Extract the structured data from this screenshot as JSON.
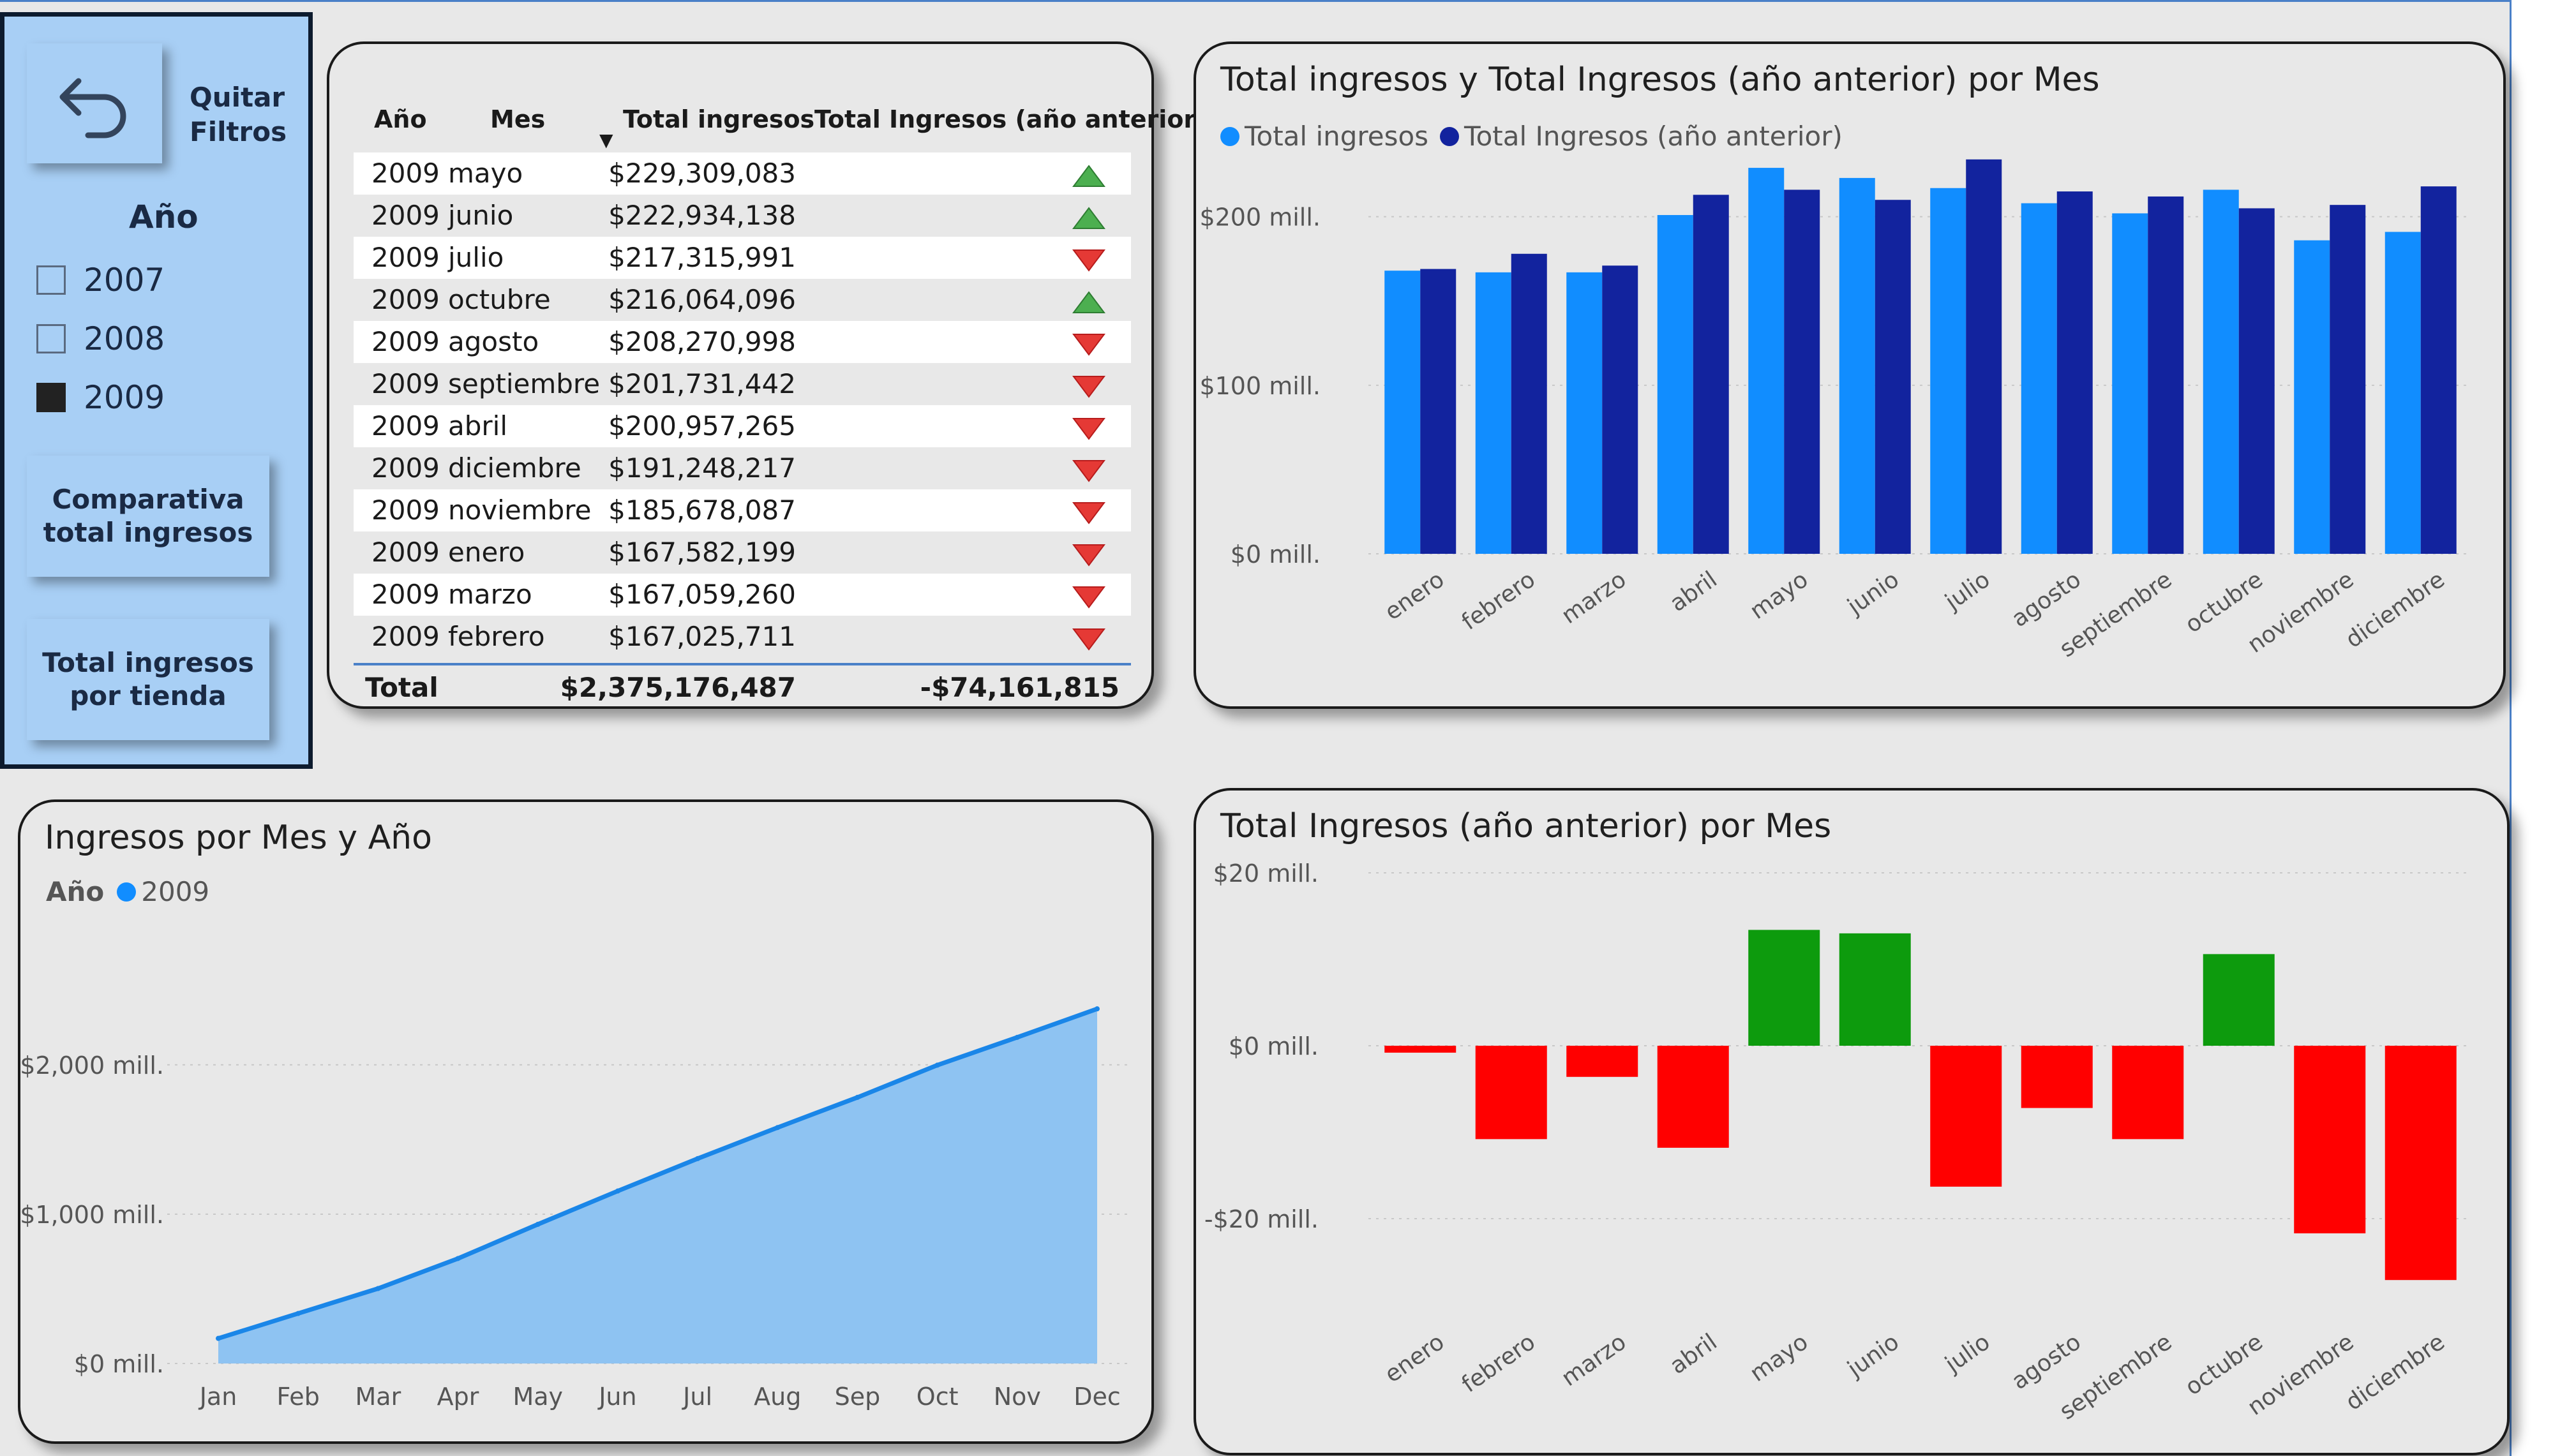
{
  "side_panel": {
    "back_button_label": "Quitar Filtros",
    "slicer_title": "Año",
    "years": [
      {
        "label": "2007",
        "checked": false
      },
      {
        "label": "2008",
        "checked": false
      },
      {
        "label": "2009",
        "checked": true
      }
    ],
    "nav_buttons": [
      "Comparativa\ntotal ingresos",
      "Total ingresos\npor tienda"
    ]
  },
  "table": {
    "headers": {
      "year": "Año",
      "month": "Mes",
      "total": "Total ingresos",
      "prev": "Total Ingresos (año anterior)"
    },
    "sort_indicator": "▼",
    "rows": [
      {
        "year": "2009",
        "month": "mayo",
        "total": "$229,309,083",
        "trend": "up"
      },
      {
        "year": "2009",
        "month": "junio",
        "total": "$222,934,138",
        "trend": "up"
      },
      {
        "year": "2009",
        "month": "julio",
        "total": "$217,315,991",
        "trend": "down"
      },
      {
        "year": "2009",
        "month": "octubre",
        "total": "$216,064,096",
        "trend": "up"
      },
      {
        "year": "2009",
        "month": "agosto",
        "total": "$208,270,998",
        "trend": "down"
      },
      {
        "year": "2009",
        "month": "septiembre",
        "total": "$201,731,442",
        "trend": "down"
      },
      {
        "year": "2009",
        "month": "abril",
        "total": "$200,957,265",
        "trend": "down"
      },
      {
        "year": "2009",
        "month": "diciembre",
        "total": "$191,248,217",
        "trend": "down"
      },
      {
        "year": "2009",
        "month": "noviembre",
        "total": "$185,678,087",
        "trend": "down"
      },
      {
        "year": "2009",
        "month": "enero",
        "total": "$167,582,199",
        "trend": "down"
      },
      {
        "year": "2009",
        "month": "marzo",
        "total": "$167,059,260",
        "trend": "down"
      },
      {
        "year": "2009",
        "month": "febrero",
        "total": "$167,025,711",
        "trend": "down"
      }
    ],
    "total_label": "Total",
    "total_value": "$2,375,176,487",
    "total_prev": "-$74,161,815"
  },
  "colors": {
    "current": "#118dff",
    "previous": "#12239e",
    "area_line": "#1a86e8",
    "area_fill": "#8ec3f2",
    "positive": "#0d9b0d",
    "negative": "#ff0000",
    "up_arrow": "#4caf50",
    "down_arrow": "#e53935"
  },
  "chart_data": [
    {
      "type": "bar",
      "title": "Total ingresos y Total Ingresos (año anterior) por Mes",
      "categories": [
        "enero",
        "febrero",
        "marzo",
        "abril",
        "mayo",
        "junio",
        "julio",
        "agosto",
        "septiembre",
        "octubre",
        "noviembre",
        "diciembre"
      ],
      "series": [
        {
          "name": "Total ingresos",
          "values": [
            168,
            167,
            167,
            201,
            229,
            223,
            217,
            208,
            202,
            216,
            186,
            191
          ]
        },
        {
          "name": "Total Ingresos (año anterior)",
          "values": [
            169,
            178,
            171,
            213,
            216,
            210,
            234,
            215,
            212,
            205,
            207,
            218
          ]
        }
      ],
      "yticks": [
        "$0 mill.",
        "$100 mill.",
        "$200 mill."
      ],
      "ylim": [
        0,
        240
      ],
      "grid": true,
      "legend": "top-left"
    },
    {
      "type": "area",
      "title": "Ingresos por Mes y Año",
      "legend_title": "Año",
      "categories": [
        "Jan",
        "Feb",
        "Mar",
        "Apr",
        "May",
        "Jun",
        "Jul",
        "Aug",
        "Sep",
        "Oct",
        "Nov",
        "Dec"
      ],
      "series": [
        {
          "name": "2009",
          "values": [
            168,
            335,
            502,
            703,
            932,
            1155,
            1372,
            1580,
            1782,
            1998,
            2184,
            2375
          ]
        }
      ],
      "yticks": [
        "$0 mill.",
        "$1,000 mill.",
        "$2,000 mill."
      ],
      "ylim": [
        0,
        2350
      ],
      "grid": true
    },
    {
      "type": "bar",
      "title": "Total Ingresos (año anterior) por Mes",
      "categories": [
        "enero",
        "febrero",
        "marzo",
        "abril",
        "mayo",
        "junio",
        "julio",
        "agosto",
        "septiembre",
        "octubre",
        "noviembre",
        "diciembre"
      ],
      "values": [
        -0.8,
        -10.8,
        -3.6,
        -11.8,
        13.4,
        13.0,
        -16.3,
        -7.2,
        -10.8,
        10.6,
        -21.7,
        -27.1
      ],
      "yticks": [
        "$20 mill.",
        "$0 mill.",
        "-$20 mill."
      ],
      "ylim": [
        -30,
        20
      ],
      "grid": true
    }
  ]
}
